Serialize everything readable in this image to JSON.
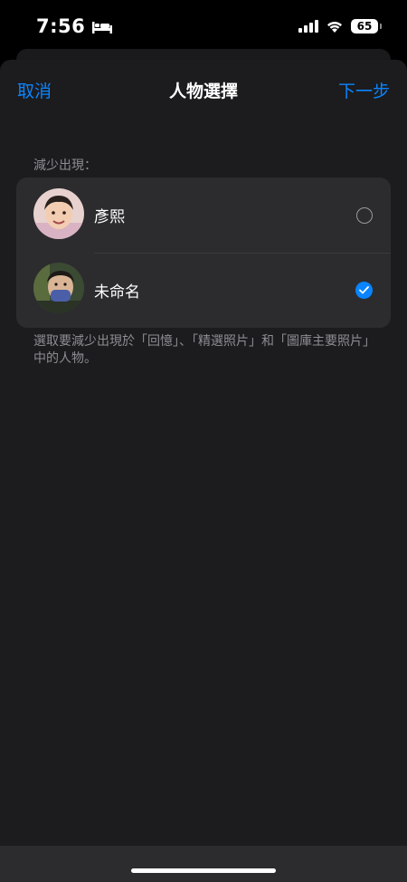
{
  "status_bar": {
    "time": "7:56",
    "battery": "65",
    "icons": [
      "bed-icon",
      "signal-icon",
      "wifi-icon",
      "battery-icon"
    ]
  },
  "nav": {
    "cancel_label": "取消",
    "title": "人物選擇",
    "next_label": "下一步"
  },
  "section": {
    "header": "減少出現："
  },
  "people": [
    {
      "name": "彥熙",
      "selected": false
    },
    {
      "name": "未命名",
      "selected": true
    }
  ],
  "footer_note": "選取要減少出現於「回憶」、「精選照片」和「圖庫主要照片」中的人物。",
  "colors": {
    "accent": "#0a84ff",
    "sheet_background": "#1c1c1e",
    "list_background": "#2c2c2e",
    "secondary_text": "#8d8d93"
  }
}
